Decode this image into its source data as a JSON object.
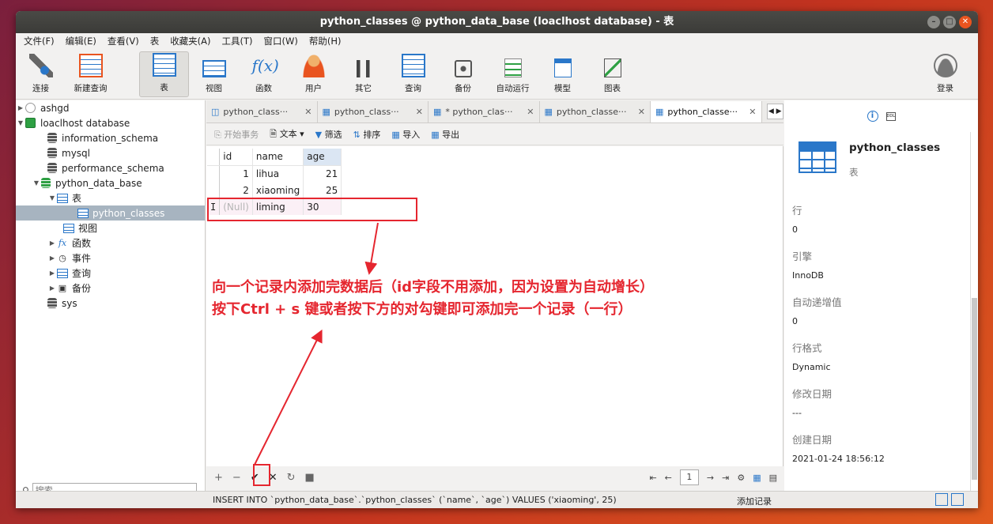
{
  "window": {
    "title": "python_classes @ python_data_base (loaclhost database) - 表"
  },
  "menu": [
    "文件(F)",
    "编辑(E)",
    "查看(V)",
    "表",
    "收藏夹(A)",
    "工具(T)",
    "窗口(W)",
    "帮助(H)"
  ],
  "toolbar": {
    "connect": "连接",
    "new_query": "新建查询",
    "table": "表",
    "view": "视图",
    "function": "函数",
    "user": "用户",
    "other": "其它",
    "query": "查询",
    "backup": "备份",
    "auto_run": "自动运行",
    "model": "模型",
    "chart": "图表",
    "login": "登录"
  },
  "tree": {
    "ashgd": "ashgd",
    "localhost": "loaclhost database",
    "information_schema": "information_schema",
    "mysql": "mysql",
    "performance_schema": "performance_schema",
    "python_data_base": "python_data_base",
    "tables": "表",
    "python_classes": "python_classes",
    "views": "视图",
    "functions": "函数",
    "events": "事件",
    "queries": "查询",
    "backups": "备份",
    "sys": "sys"
  },
  "search": {
    "placeholder": "搜索"
  },
  "tabs": [
    {
      "label": "python_class···"
    },
    {
      "label": "python_class···"
    },
    {
      "label": "* python_clas···"
    },
    {
      "label": "python_classe···"
    },
    {
      "label": "python_classe···"
    }
  ],
  "subbar": {
    "begin_tx": "开始事务",
    "text": "文本",
    "filter": "筛选",
    "sort": "排序",
    "import": "导入",
    "export": "导出"
  },
  "grid": {
    "headers": {
      "id": "id",
      "name": "name",
      "age": "age"
    },
    "rows": [
      {
        "id": "1",
        "name": "lihua",
        "age": "21"
      },
      {
        "id": "2",
        "name": "xiaoming",
        "age": "25"
      }
    ],
    "new_row": {
      "cursor": "I",
      "id": "(Null)",
      "name": "liming",
      "age": "30"
    }
  },
  "annotation": {
    "line1": "向一个记录内添加完数据后（id字段不用添加，因为设置为自动增长）",
    "line2": "按下Ctrl + s 键或者按下方的对勾键即可添加完一个记录（一行）"
  },
  "pager": {
    "page": "1"
  },
  "status": {
    "sql": "INSERT INTO `python_data_base`.`python_classes` (`name`, `age`) VALUES ('xiaoming', 25)",
    "mode": "添加记录"
  },
  "info": {
    "name": "python_classes",
    "type": "表",
    "props": [
      {
        "k": "行",
        "v": "0"
      },
      {
        "k": "引擎",
        "v": "InnoDB"
      },
      {
        "k": "自动递增值",
        "v": "0"
      },
      {
        "k": "行格式",
        "v": "Dynamic"
      },
      {
        "k": "修改日期",
        "v": "---"
      },
      {
        "k": "创建日期",
        "v": "2021-01-24 18:56:12"
      }
    ]
  },
  "colors": {
    "accent": "#2a77c9",
    "annotation": "#e5262f",
    "ubuntu_orange": "#e9541f"
  }
}
